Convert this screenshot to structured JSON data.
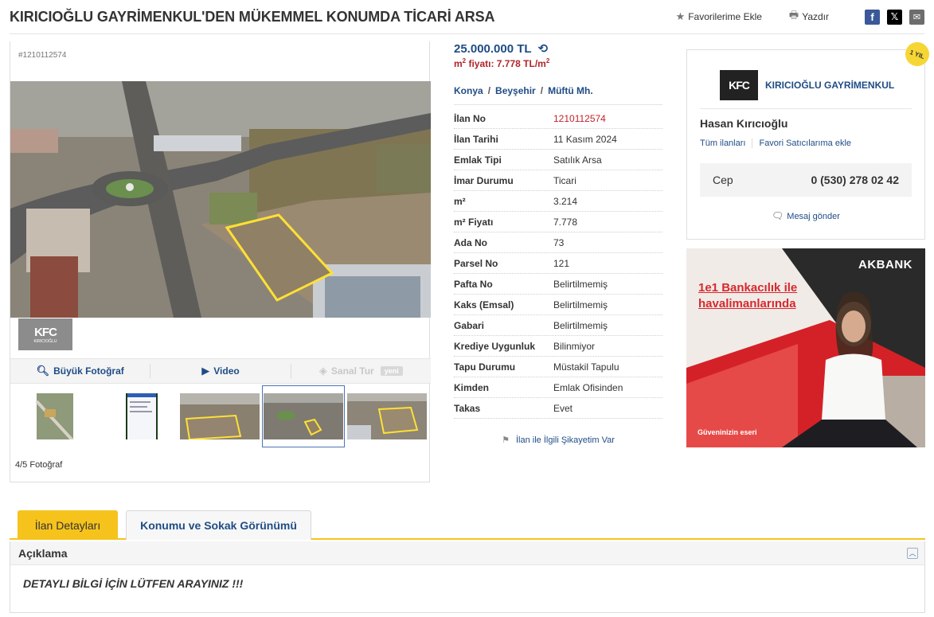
{
  "header": {
    "title": "KIRICIOĞLU GAYRİMENKUL'DEN MÜKEMMEL KONUMDA TİCARİ ARSA",
    "favorite_label": "Favorilerime Ekle",
    "print_label": "Yazdır",
    "social": [
      "facebook-icon",
      "x-icon",
      "mail-icon"
    ]
  },
  "gallery": {
    "ad_no": "#1210112574",
    "logo_line1": "KFC",
    "logo_line2": "KIRICIOĞLU",
    "tabs": {
      "big_photo": "Büyük Fotoğraf",
      "video": "Video",
      "virtual_tour": "Sanal Tur",
      "new_badge": "yeni"
    },
    "photo_count": "4/5 Fotoğraf"
  },
  "listing": {
    "price": "25.000.000 TL",
    "m2_price_prefix": "m",
    "m2_price_sup": "2",
    "m2_price_mid": " fiyatı: 7.778 TL/m",
    "m2_price_sup2": "2",
    "location": [
      "Konya",
      "Beyşehir",
      "Müftü Mh."
    ],
    "details": [
      {
        "key": "İlan No",
        "value": "1210112574"
      },
      {
        "key": "İlan Tarihi",
        "value": "11 Kasım 2024"
      },
      {
        "key": "Emlak Tipi",
        "value": "Satılık Arsa"
      },
      {
        "key": "İmar Durumu",
        "value": "Ticari"
      },
      {
        "key": "m²",
        "value": "3.214"
      },
      {
        "key": "m² Fiyatı",
        "value": "7.778"
      },
      {
        "key": "Ada No",
        "value": "73"
      },
      {
        "key": "Parsel No",
        "value": "121"
      },
      {
        "key": "Pafta No",
        "value": "Belirtilmemiş"
      },
      {
        "key": "Kaks (Emsal)",
        "value": "Belirtilmemiş"
      },
      {
        "key": "Gabari",
        "value": "Belirtilmemiş"
      },
      {
        "key": "Krediye Uygunluk",
        "value": "Bilinmiyor"
      },
      {
        "key": "Tapu Durumu",
        "value": "Müstakil Tapulu"
      },
      {
        "key": "Kimden",
        "value": "Emlak Ofisinden"
      },
      {
        "key": "Takas",
        "value": "Evet"
      }
    ],
    "complaint": "İlan ile İlgili Şikayetim Var"
  },
  "seller": {
    "badge": "1 YIL",
    "logo_text": "KFC",
    "firm_name": "KIRICIOĞLU GAYRİMENKUL",
    "person": "Hasan Kırıcıoğlu",
    "all_ads": "Tüm ilanları",
    "fav_seller": "Favori Satıcılarıma ekle",
    "phone_label": "Cep",
    "phone": "0 (530) 278 02 42",
    "message": "Mesaj gönder"
  },
  "banner": {
    "brand": "AKBANK",
    "slogan_line1": "1e1 Bankacılık ile",
    "slogan_line2": "havalimanlarında",
    "footer": "Güveninizin eseri"
  },
  "tabs": {
    "details": "İlan Detayları",
    "location": "Konumu ve Sokak Görünümü"
  },
  "description": {
    "title": "Açıklama",
    "text": "DETAYLI BİLGİ İÇİN LÜTFEN ARAYINIZ !!!"
  },
  "colors": {
    "link_blue": "#1f4c86",
    "accent_yellow": "#f6c31c",
    "price_red": "#b0242a"
  }
}
